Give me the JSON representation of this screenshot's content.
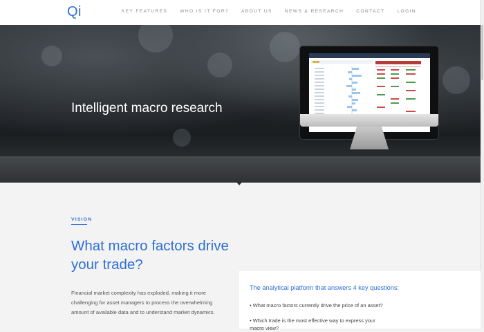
{
  "header": {
    "logo": "Qi",
    "nav": [
      "KEY FEATURES",
      "WHO IS IT FOR?",
      "ABOUT US",
      "NEWS & RESEARCH",
      "CONTACT",
      "LOGIN"
    ]
  },
  "hero": {
    "title": "Intelligent macro research"
  },
  "vision": {
    "label": "VISION",
    "heading": "What macro factors drive your trade?",
    "paragraph": "Financial market complexity has exploded, making it more challenging for asset managers to process the overwhelming amount of available data and to understand market dynamics."
  },
  "panel": {
    "title": "The analytical platform that answers 4 key questions:",
    "questions": [
      "• What macro factors currently drive the price of an asset?",
      "• Which trade is the most effective way to express your macro view?"
    ]
  },
  "colors": {
    "accent": "#2f6fd6",
    "hero_text": "#ffffff"
  }
}
